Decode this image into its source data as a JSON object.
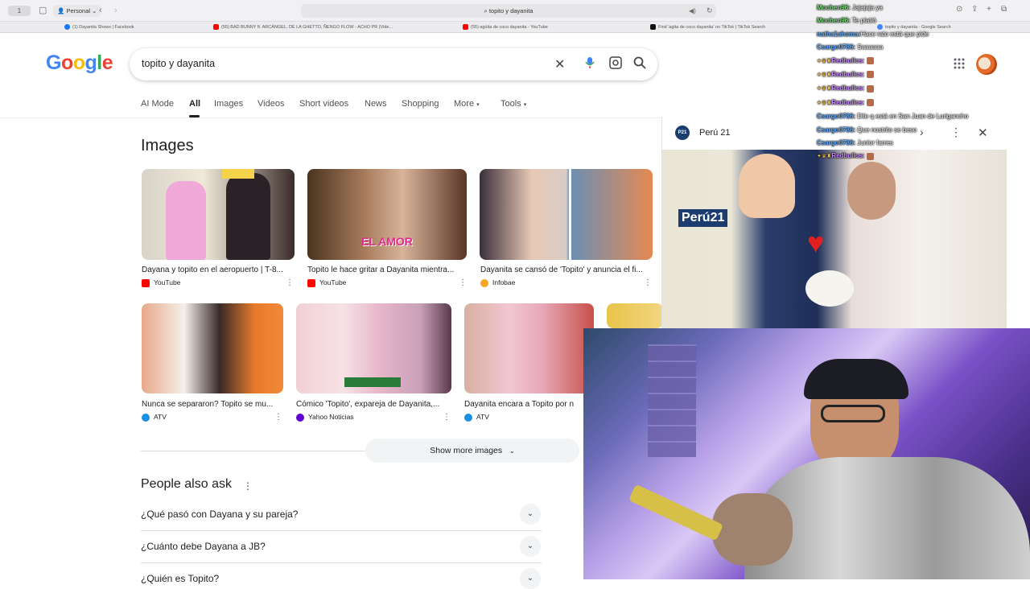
{
  "browser": {
    "tab_count": "1",
    "profile": "Personal",
    "address": "topito y dayanita",
    "tabs": [
      {
        "label": "(1) Dayanita Shows | Facebook",
        "color": "#1877f2"
      },
      {
        "label": "(55) BAD BUNNY ft. ARCÁNGEL, DE LA GHETTO, ÑENGO FLOW - ACHO PR (Vide...",
        "color": "#ff0000"
      },
      {
        "label": "(55) agüita de coco dayanita - YouTube",
        "color": "#ff0000"
      },
      {
        "label": "Find 'agita de coco dayanita' on TikTok | TikTok Search",
        "color": "#111111"
      },
      {
        "label": "topito y dayanita - Google Search",
        "color": "#4285f4"
      }
    ]
  },
  "google": {
    "logo_letters": [
      {
        "ch": "G",
        "color": "#4285f4"
      },
      {
        "ch": "o",
        "color": "#ea4335"
      },
      {
        "ch": "o",
        "color": "#fbbc05"
      },
      {
        "ch": "g",
        "color": "#4285f4"
      },
      {
        "ch": "l",
        "color": "#34a853"
      },
      {
        "ch": "e",
        "color": "#ea4335"
      }
    ],
    "query": "topito y dayanita",
    "nav": [
      "AI Mode",
      "All",
      "Images",
      "Videos",
      "Short videos",
      "News",
      "Shopping",
      "More",
      "Tools"
    ]
  },
  "images": {
    "title": "Images",
    "row1": [
      {
        "caption": "Dayana y topito en el aeropuerto | T-8...",
        "source": "YouTube",
        "src_color": "#ff0000"
      },
      {
        "caption": "Topito le hace gritar a Dayanita mientra...",
        "source": "YouTube",
        "src_color": "#ff0000"
      },
      {
        "caption": "Dayanita se cansó de 'Topito' y anuncia el fi...",
        "source": "Infobae",
        "src_color": "#f5a623"
      }
    ],
    "row2": [
      {
        "caption": "Nunca se separaron? Topito se mu...",
        "source": "ATV",
        "src_color": "#1a8fe3"
      },
      {
        "caption": "Cómico 'Topito', expareja de Dayanita,...",
        "source": "Yahoo Noticias",
        "src_color": "#6001d2"
      },
      {
        "caption": "Dayanita encara a Topito por n",
        "source": "ATV",
        "src_color": "#1a8fe3"
      }
    ],
    "thumb_text": "EL AMOR",
    "show_more": "Show more images"
  },
  "paa": {
    "title": "People also ask",
    "questions": [
      "¿Qué pasó con Dayana y su pareja?",
      "¿Cuánto debe Dayana a JB?",
      "¿Quién es Topito?"
    ]
  },
  "panel": {
    "source": "Perú 21",
    "logo": "P21",
    "watermark": "Perú21"
  },
  "chat": [
    {
      "user": "Mochen96:",
      "msg": "Jajajaja ya",
      "cls": ""
    },
    {
      "user": "Mochen96:",
      "msg": "Te platió",
      "cls": ""
    },
    {
      "user": "natha1ahoma:",
      "msg": "Hace rato está que pide",
      "cls": "blue"
    },
    {
      "user": "Csargo0786:",
      "msg": "Saaaaaa",
      "cls": "blue"
    },
    {
      "user": "Redbullcs:",
      "msg": "",
      "cls": "purple",
      "badges": true
    },
    {
      "user": "Redbullcs:",
      "msg": "",
      "cls": "purple",
      "badges": true
    },
    {
      "user": "Redbullcs:",
      "msg": "",
      "cls": "purple",
      "badges": true
    },
    {
      "user": "Redbullcs:",
      "msg": "",
      "cls": "purple",
      "badges": true
    },
    {
      "user": "Csargo0786:",
      "msg": "Dile q está en San Juan de Lurigancho",
      "cls": "blue"
    },
    {
      "user": "Csargo0786:",
      "msg": "Que nostrito se beso",
      "cls": "blue"
    },
    {
      "user": "Csargo0786:",
      "msg": "Junior farres",
      "cls": "blue"
    },
    {
      "user": "Redbullcs:",
      "msg": "",
      "cls": "purple",
      "badges": true
    }
  ]
}
